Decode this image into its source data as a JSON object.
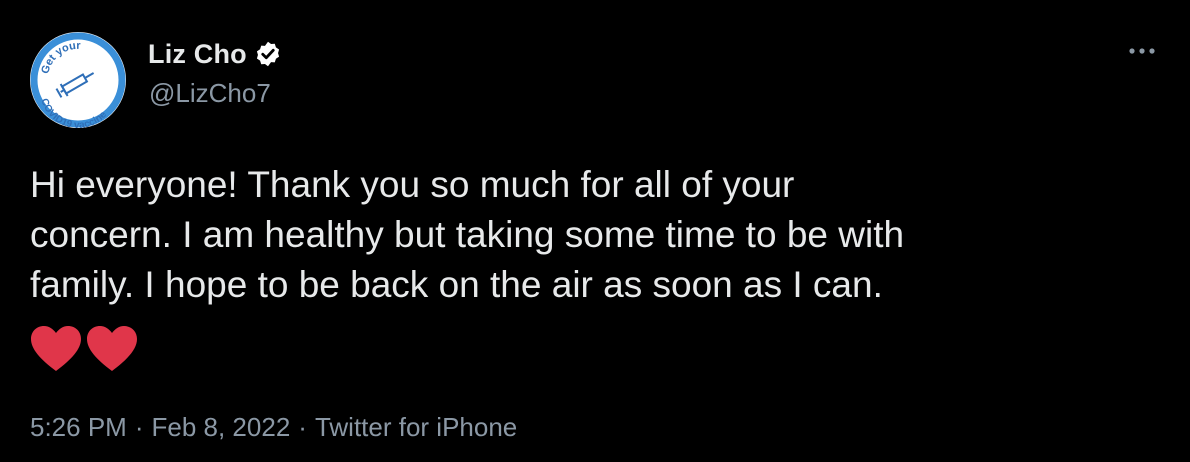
{
  "author": {
    "name": "Liz Cho",
    "handle": "@LizCho7",
    "verified": true
  },
  "avatar": {
    "badge_top_text": "Get your",
    "badge_bottom_text": "COVID19 vaccine",
    "ring_color": "#3a8fd8",
    "icon": "syringe-icon"
  },
  "tweet": {
    "lines": [
      "Hi everyone! Thank you so much for all of your",
      "concern. I am healthy but taking some time to be with",
      "family. I hope to be back on the air as soon as I can."
    ],
    "emoji": [
      "heart-emoji",
      "heart-emoji"
    ]
  },
  "meta": {
    "time": "5:26 PM",
    "separator": "·",
    "date": "Feb 8, 2022",
    "source": "Twitter for iPhone"
  },
  "colors": {
    "background": "#000000",
    "text": "#e7e9ea",
    "secondary_text": "#8b98a5",
    "heart": "#e0364a"
  }
}
